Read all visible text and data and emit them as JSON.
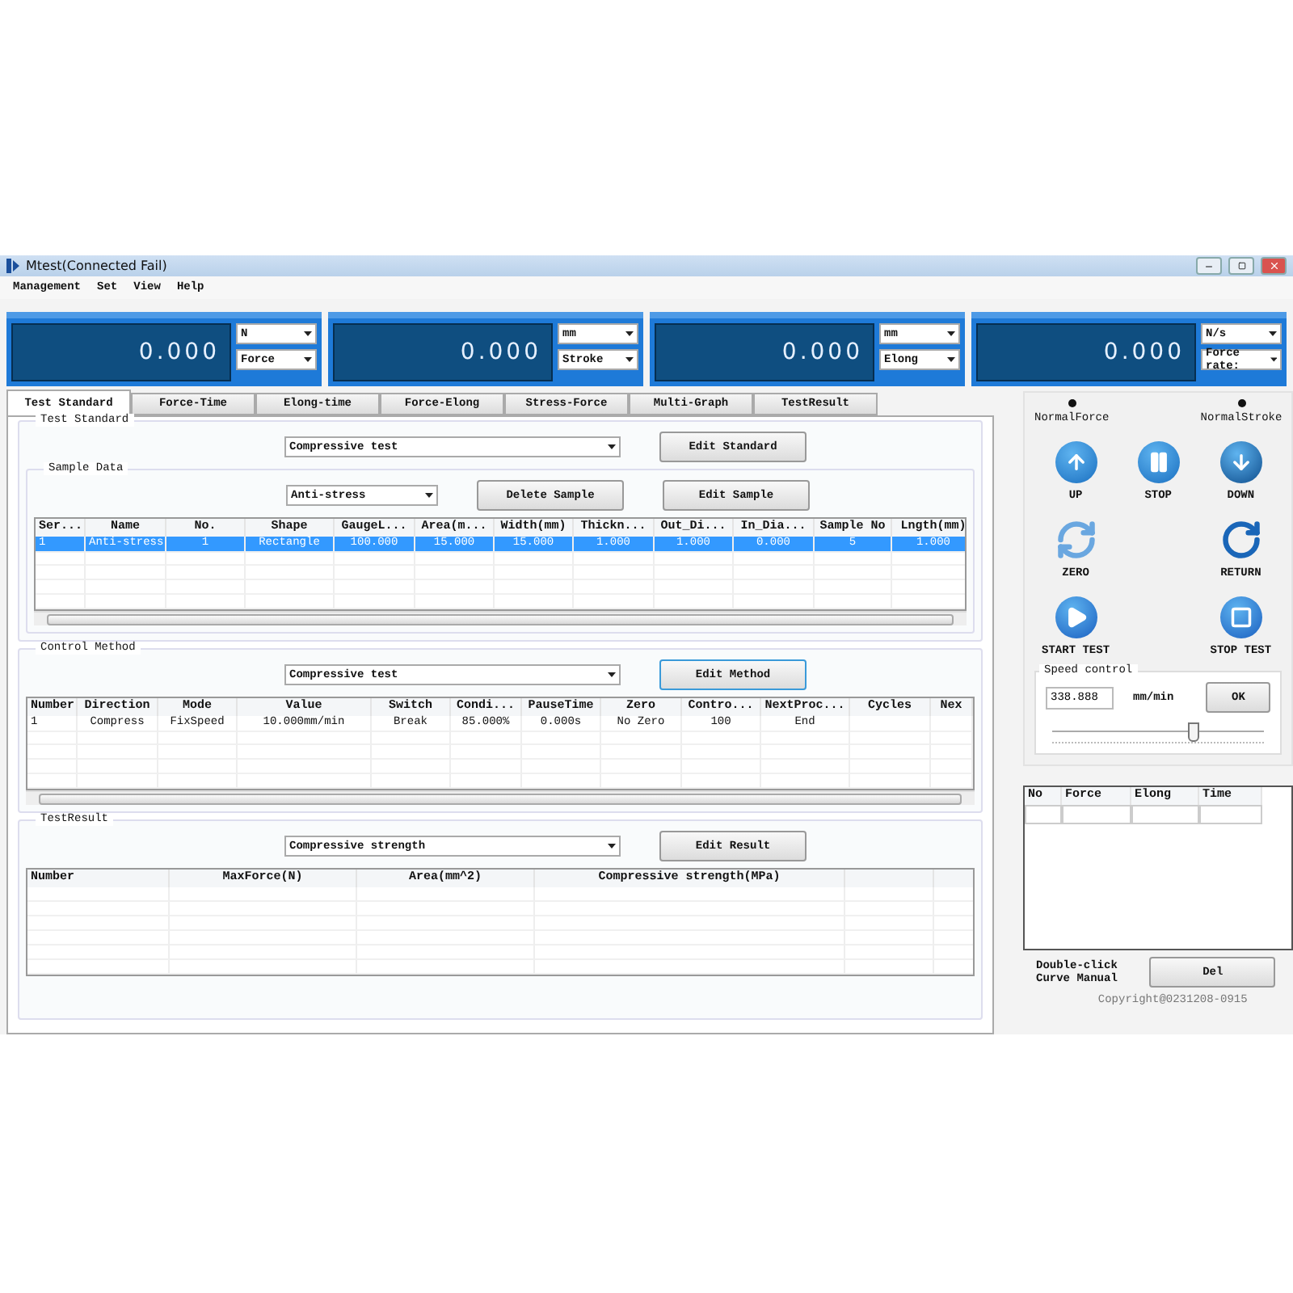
{
  "window": {
    "title": "Mtest(Connected Fail)"
  },
  "menu": [
    "Management",
    "Set",
    "View",
    "Help"
  ],
  "readouts": [
    {
      "value": "0.000",
      "unit": "N",
      "quantity": "Force"
    },
    {
      "value": "0.000",
      "unit": "mm",
      "quantity": "Stroke"
    },
    {
      "value": "0.000",
      "unit": "mm",
      "quantity": "Elong"
    },
    {
      "value": "0.000",
      "unit": "N/s",
      "quantity": "Force rate:"
    }
  ],
  "tabs": [
    {
      "label": "Test Standard",
      "selected": true
    },
    {
      "label": "Force-Time",
      "selected": false
    },
    {
      "label": "Elong-time",
      "selected": false
    },
    {
      "label": "Force-Elong",
      "selected": false
    },
    {
      "label": "Stress-Force",
      "selected": false
    },
    {
      "label": "Multi-Graph",
      "selected": false
    },
    {
      "label": "TestResult",
      "selected": false
    }
  ],
  "test_standard": {
    "title": "Test Standard",
    "standard": "Compressive test",
    "button": "Edit Standard"
  },
  "sample_data": {
    "title": "Sample Data",
    "sample": "Anti-stress",
    "buttons": [
      "Delete Sample",
      "Edit Sample"
    ],
    "table": {
      "columns": [
        "Ser...",
        "Name",
        "No.",
        "Shape",
        "GaugeL...",
        "Area(m...",
        "Width(mm)",
        "Thickn...",
        "Out_Di...",
        "In_Dia...",
        "Sample No",
        "Lngth(mm)"
      ],
      "rows": [
        {
          "selected": true,
          "cells": [
            "1",
            "Anti-stress",
            "1",
            "Rectangle",
            "100.000",
            "15.000",
            "15.000",
            "1.000",
            "1.000",
            "0.000",
            "5",
            "1.000"
          ]
        }
      ]
    }
  },
  "control_method": {
    "title": "Control Method",
    "method": "Compressive test",
    "button": "Edit Method",
    "table": {
      "columns": [
        "Number",
        "Direction",
        "Mode",
        "Value",
        "Switch",
        "Condi...",
        "PauseTime",
        "Zero",
        "Contro...",
        "NextProc...",
        "Cycles",
        "Nex"
      ],
      "rows": [
        {
          "selected": false,
          "cells": [
            "1",
            "Compress",
            "FixSpeed",
            "10.000mm/min",
            "Break",
            "85.000%",
            "0.000s",
            "No Zero",
            "100",
            "End",
            "",
            ""
          ]
        }
      ]
    }
  },
  "test_result": {
    "title": "TestResult",
    "result": "Compressive strength",
    "button": "Edit Result",
    "table": {
      "columns": [
        "Number",
        "MaxForce(N)",
        "Area(mm^2)",
        "Compressive strength(MPa)"
      ]
    }
  },
  "indicators": [
    "NormalForce",
    "NormalStroke"
  ],
  "controls": [
    {
      "label": "UP",
      "kind": "up"
    },
    {
      "label": "STOP",
      "kind": "pause"
    },
    {
      "label": "DOWN",
      "kind": "down"
    },
    {
      "label": "ZERO",
      "kind": "zero"
    },
    {
      "label": "RETURN",
      "kind": "return"
    },
    {
      "label": "START TEST",
      "kind": "start"
    },
    {
      "label": "STOP TEST",
      "kind": "stop"
    }
  ],
  "speed_control": {
    "title": "Speed control",
    "value": "338.888",
    "unit": "mm/min",
    "button": "OK",
    "level": 0.66
  },
  "points_table": {
    "columns": [
      "No",
      "Force",
      "Elong",
      "Time"
    ]
  },
  "curve_hint": "Double-click\nCurve Manual",
  "delete_button": "Del",
  "copyright": "Copyright@0231208-0915"
}
